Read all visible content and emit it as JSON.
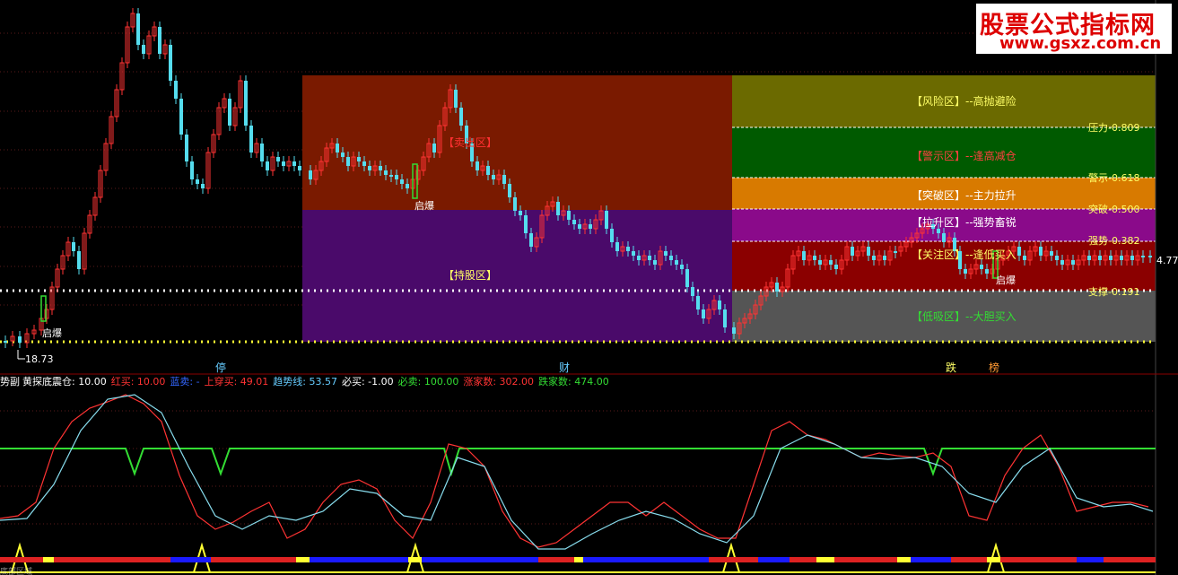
{
  "watermark": {
    "title": "股票公式指标网",
    "url": "www.gsxz.com.cn"
  },
  "price_labels": {
    "low": "18.73",
    "right_edge": "4.77"
  },
  "zones": [
    {
      "id": "risk",
      "label": "【风险区】--高抛避险",
      "color": "#6b6a00",
      "text_color": "#ffff66"
    },
    {
      "id": "warn",
      "label": "【警示区】--逢高减仓",
      "color": "#005a00",
      "text_color": "#ff4040"
    },
    {
      "id": "breakout",
      "label": "【突破区】--主力拉升",
      "color": "#d87a00",
      "text_color": "#ffffff"
    },
    {
      "id": "pull",
      "label": "【拉升区】--强势畜锐",
      "color": "#8a0a8a",
      "text_color": "#ffffff"
    },
    {
      "id": "watch",
      "label": "【关注区】--逢低买入",
      "color": "#8b0000",
      "text_color": "#ffff66"
    },
    {
      "id": "low",
      "label": "【低吸区】--大胆买入",
      "color": "#555555",
      "text_color": "#33dd33"
    }
  ],
  "left_zones": [
    {
      "id": "sell_zone",
      "label": "【卖出区】",
      "color": "#7a1a00",
      "text_color": "#ff3030"
    },
    {
      "id": "hold_zone",
      "label": "【持股区】",
      "color": "#4a0a6a",
      "text_color": "#ffff66"
    }
  ],
  "levels": [
    {
      "name": "压力",
      "value": "0.809",
      "text": "压力-0.809"
    },
    {
      "name": "警示",
      "value": "0.618",
      "text": "警示-0.618"
    },
    {
      "name": "突破",
      "value": "0.500",
      "text": "突破-0.500"
    },
    {
      "name": "强势",
      "value": "0.382",
      "text": "强势-0.382"
    },
    {
      "name": "支撑",
      "value": "0.191",
      "text": "支撑-0.191"
    }
  ],
  "markers": {
    "qibao_1": "启爆",
    "qibao_2": "启爆",
    "qibao_3": "启爆"
  },
  "axis_events": [
    {
      "text": "停",
      "color": "#66ccff"
    },
    {
      "text": "财",
      "color": "#66ccff"
    },
    {
      "text": "跌",
      "color": "#ffff66"
    },
    {
      "text": "榜",
      "color": "#ff9933"
    }
  ],
  "indicator": {
    "name": "势副",
    "items": [
      {
        "text": "黄探底震仓: 10.00",
        "color": "#ffffff"
      },
      {
        "text": "红买: 10.00",
        "color": "#ff3333"
      },
      {
        "text": "蓝卖: -",
        "color": "#3366ff"
      },
      {
        "text": "上穿买: 49.01",
        "color": "#ff3333"
      },
      {
        "text": "趋势线: 53.57",
        "color": "#66ccff"
      },
      {
        "text": "必买: -1.00",
        "color": "#ffffff"
      },
      {
        "text": "必卖: 100.00",
        "color": "#33dd33"
      },
      {
        "text": "涨家数: 302.00",
        "color": "#ff3333"
      },
      {
        "text": "跌家数: 474.00",
        "color": "#33dd33"
      }
    ]
  },
  "bottom_label": "底部区域"
}
